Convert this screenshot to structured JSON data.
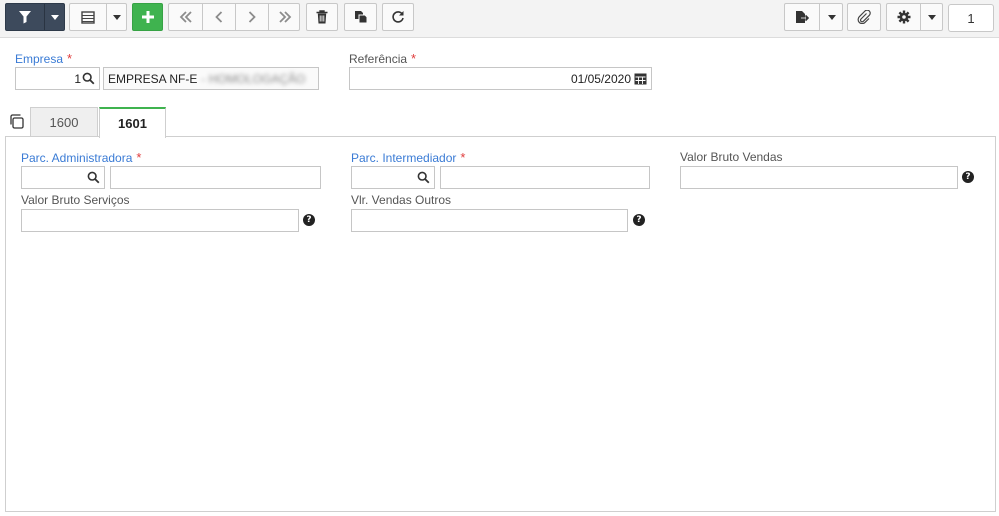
{
  "toolbar": {
    "buttons": [
      {
        "name": "filter-button",
        "icon": "filter-icon"
      },
      {
        "name": "filter-dropdown-button",
        "icon": "chevron-down-icon"
      },
      {
        "name": "list-view-button",
        "icon": "list-icon"
      },
      {
        "name": "list-view-dropdown-button",
        "icon": "chevron-down-icon"
      },
      {
        "name": "add-button",
        "icon": "plus-icon"
      },
      {
        "name": "first-record-button",
        "icon": "double-chevron-left-icon"
      },
      {
        "name": "previous-record-button",
        "icon": "chevron-left-icon"
      },
      {
        "name": "next-record-button",
        "icon": "chevron-right-icon"
      },
      {
        "name": "last-record-button",
        "icon": "double-chevron-right-icon"
      },
      {
        "name": "delete-button",
        "icon": "trash-icon"
      },
      {
        "name": "duplicate-button",
        "icon": "copy-icon"
      },
      {
        "name": "refresh-button",
        "icon": "refresh-icon"
      },
      {
        "name": "export-button",
        "icon": "file-export-icon"
      },
      {
        "name": "export-dropdown-button",
        "icon": "chevron-down-icon"
      },
      {
        "name": "attachment-button",
        "icon": "paperclip-icon"
      },
      {
        "name": "settings-button",
        "icon": "gear-icon"
      },
      {
        "name": "settings-dropdown-button",
        "icon": "chevron-down-icon"
      }
    ],
    "record_number": "1"
  },
  "header": {
    "empresa": {
      "label": "Empresa",
      "code": "1",
      "name": "EMPRESA NF-E",
      "name_obscured": "- HOMOLOGAÇÃO"
    },
    "referencia": {
      "label": "Referência",
      "value": "01/05/2020"
    }
  },
  "tabs": [
    {
      "label": "1600",
      "active": false
    },
    {
      "label": "1601",
      "active": true
    }
  ],
  "form": {
    "parc_administradora": {
      "label": "Parc. Administradora",
      "required": true,
      "code": "",
      "name": ""
    },
    "parc_intermediador": {
      "label": "Parc. Intermediador",
      "required": true,
      "code": "",
      "name": ""
    },
    "valor_bruto_vendas": {
      "label": "Valor Bruto Vendas",
      "value": ""
    },
    "valor_bruto_servicos": {
      "label": "Valor Bruto Serviços",
      "value": ""
    },
    "vlr_vendas_outros": {
      "label": "Vlr. Vendas Outros",
      "value": ""
    }
  },
  "colors": {
    "accent": "#3a7bd5",
    "required_star": "#e03b3b",
    "add_green": "#3fb34f",
    "filter_dark": "#3d4a5c"
  }
}
